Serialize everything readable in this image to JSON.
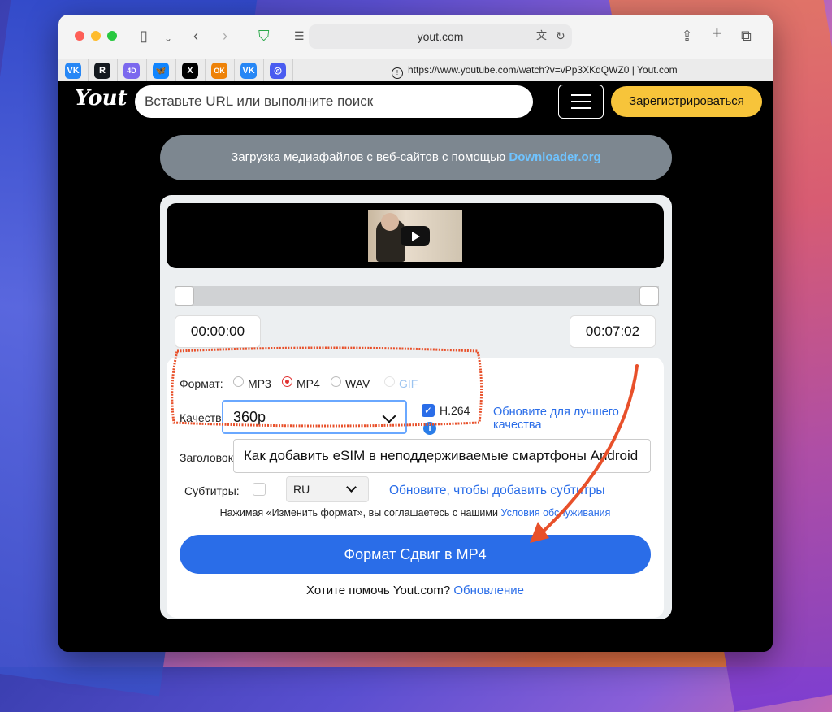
{
  "browser": {
    "address": "yout.com",
    "tab_title": "https://www.youtube.com/watch?v=vPp3XKdQWZ0 | Yout.com",
    "favorites": [
      {
        "icon": "vk-icon",
        "text": "VK",
        "color": "#2787f5"
      },
      {
        "icon": "rutube-icon",
        "text": "R",
        "color": "#14191f"
      },
      {
        "icon": "app-4d-icon",
        "text": "4D",
        "color": "#7b68ee"
      },
      {
        "icon": "bluesky-icon",
        "text": "🦋",
        "color": "#1185fe"
      },
      {
        "icon": "x-icon",
        "text": "X",
        "color": "#000000"
      },
      {
        "icon": "odnoklassniki-icon",
        "text": "OK",
        "color": "#ee8208"
      },
      {
        "icon": "vk-icon",
        "text": "VK",
        "color": "#2787f5"
      },
      {
        "icon": "app-circle-icon",
        "text": "◎",
        "color": "#4a5cf0"
      }
    ]
  },
  "header": {
    "logo": "Yout",
    "search_placeholder": "Вставьте URL или выполните поиск",
    "register_label": "Зарегистрироваться"
  },
  "banner": {
    "text": "Загрузка медиафайлов с веб-сайтов с помощью ",
    "link": "Downloader.org"
  },
  "trim": {
    "start_time": "00:00:00",
    "end_time": "00:07:02"
  },
  "options": {
    "format_label": "Формат:",
    "formats": [
      "MP3",
      "MP4",
      "WAV",
      "GIF"
    ],
    "selected_format": "MP4",
    "quality_label": "Качество",
    "quality_value": "360p",
    "codec_label": "H.264",
    "upgrade_quality_link": "Обновите для лучшего качества",
    "title_label": "Заголовок",
    "title_value": "Как добавить eSIM в неподдерживаемые смартфоны Android",
    "subtitles_label": "Субтитры:",
    "subtitles_lang": "RU",
    "subtitles_link": "Обновите, чтобы добавить субтитры",
    "terms_text": "Нажимая «Изменить формат», вы соглашаетесь с нашими ",
    "terms_link": "Условия обслуживания",
    "convert_button": "Формат Сдвиг в MP4",
    "help_text": "Хотите помочь Yout.com? ",
    "help_link": "Обновление"
  },
  "colors": {
    "accent": "#2a6de8",
    "register": "#f7c43a",
    "annotation": "#e8502a"
  }
}
